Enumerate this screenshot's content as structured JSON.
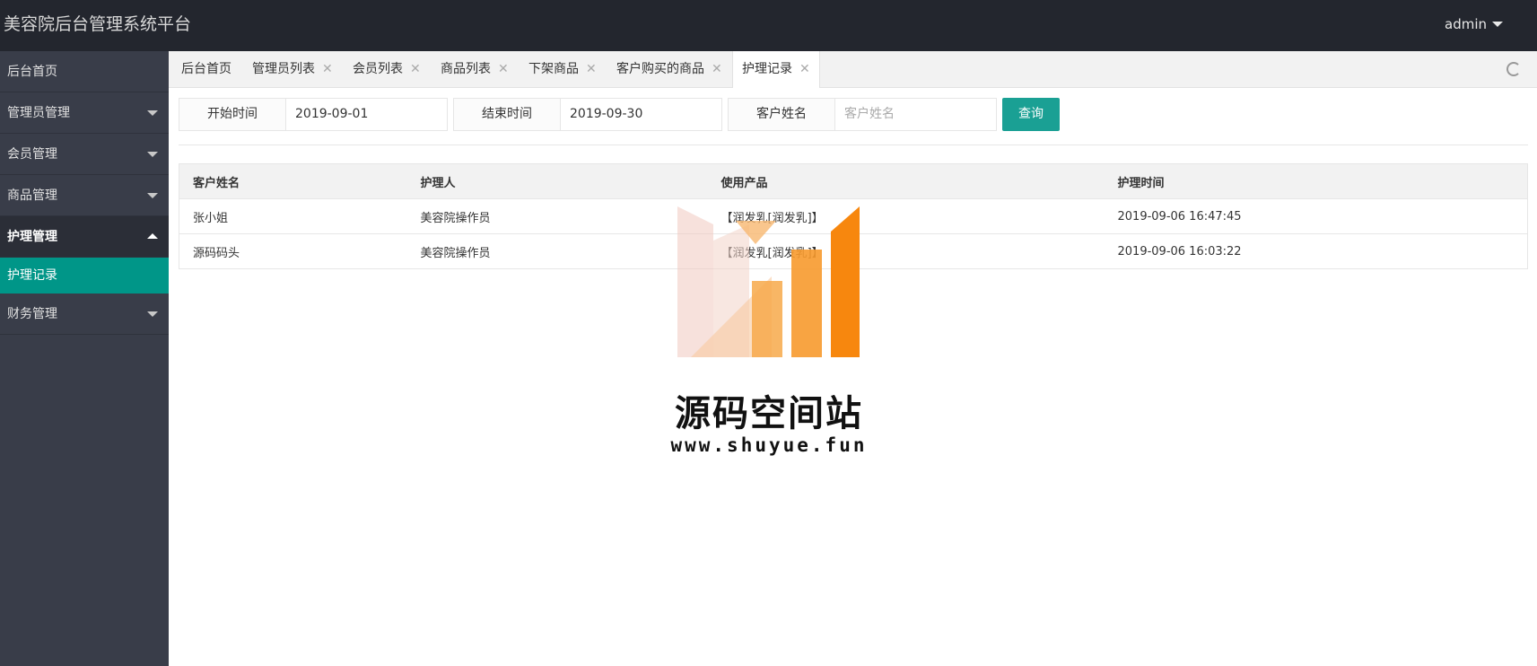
{
  "header": {
    "brand": "美容院后台管理系统平台",
    "user": "admin"
  },
  "sidebar": {
    "items": [
      {
        "label": "后台首页"
      },
      {
        "label": "管理员管理"
      },
      {
        "label": "会员管理"
      },
      {
        "label": "商品管理"
      },
      {
        "label": "护理管理"
      },
      {
        "label": "财务管理"
      }
    ],
    "active_sub": "护理记录"
  },
  "tabs": [
    {
      "label": "后台首页",
      "close": ""
    },
    {
      "label": "管理员列表",
      "close": "✕"
    },
    {
      "label": "会员列表",
      "close": "✕"
    },
    {
      "label": "商品列表",
      "close": "✕"
    },
    {
      "label": "下架商品",
      "close": "✕"
    },
    {
      "label": "客户购买的商品",
      "close": "✕"
    },
    {
      "label": "护理记录",
      "close": "✕"
    }
  ],
  "search": {
    "start_label": "开始时间",
    "start_value": "2019-09-01",
    "end_label": "结束时间",
    "end_value": "2019-09-30",
    "name_label": "客户姓名",
    "name_placeholder": "客户姓名",
    "query_button": "查询"
  },
  "table": {
    "headers": [
      "客户姓名",
      "护理人",
      "使用产品",
      "护理时间"
    ],
    "rows": [
      [
        "张小姐",
        "美容院操作员",
        "【润发乳[润发乳]】",
        "2019-09-06 16:47:45"
      ],
      [
        "源码码头",
        "美容院操作员",
        "【润发乳[润发乳]】",
        "2019-09-06 16:03:22"
      ]
    ]
  },
  "watermark": {
    "title": "源码空间站",
    "url": "www.shuyue.fun"
  },
  "colors": {
    "topbar": "#23262e",
    "sidebar": "#393d49",
    "accent": "#009688",
    "query_button": "#1aa094"
  }
}
